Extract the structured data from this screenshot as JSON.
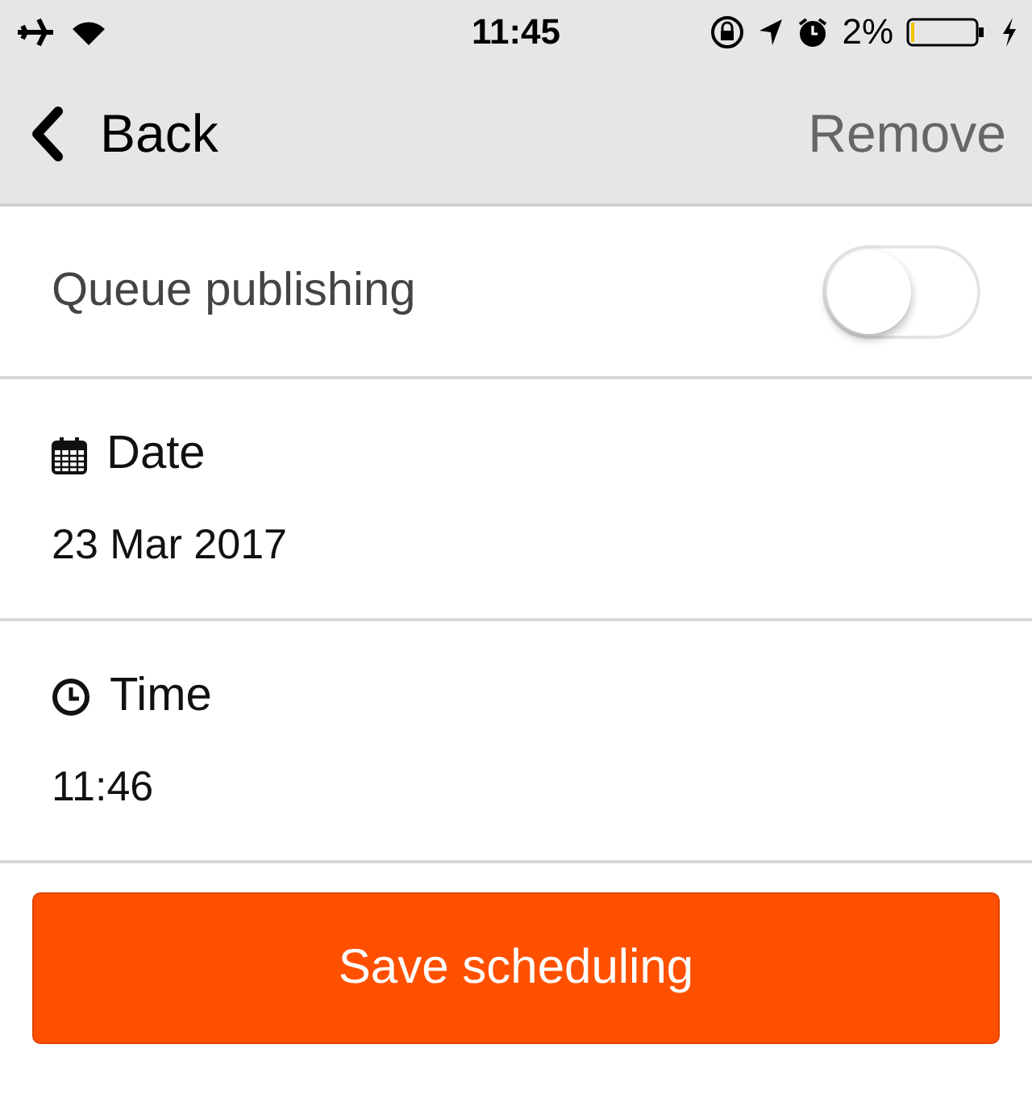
{
  "status_bar": {
    "time": "11:45",
    "battery": "2%"
  },
  "nav": {
    "back": "Back",
    "action": "Remove"
  },
  "queue": {
    "label": "Queue publishing",
    "on": false
  },
  "fields": [
    {
      "kind": "date",
      "label": "Date",
      "value": "23 Mar 2017"
    },
    {
      "kind": "time",
      "label": "Time",
      "value": "11:46"
    }
  ],
  "button": "Save scheduling"
}
